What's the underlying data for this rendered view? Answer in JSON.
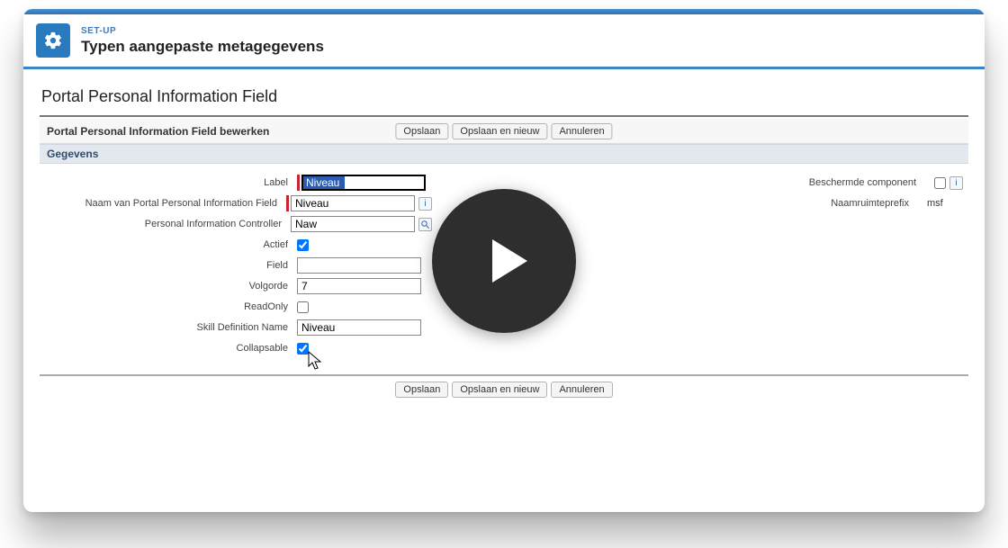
{
  "header": {
    "crumb": "SET-UP",
    "title": "Typen aangepaste metagegevens"
  },
  "page": {
    "title": "Portal Personal Information Field"
  },
  "edit": {
    "bar_title": "Portal Personal Information Field bewerken"
  },
  "buttons": {
    "save": "Opslaan",
    "save_new": "Opslaan en nieuw",
    "cancel": "Annuleren"
  },
  "section": {
    "gegevens": "Gegevens"
  },
  "labels": {
    "label": "Label",
    "name": "Naam van Portal Personal Information Field",
    "controller": "Personal Information Controller",
    "active": "Actief",
    "field": "Field",
    "order": "Volgorde",
    "readonly": "ReadOnly",
    "skill": "Skill Definition Name",
    "collapsable": "Collapsable",
    "protected": "Beschermde component",
    "nsprefix": "Naamruimteprefix"
  },
  "values": {
    "label": "Niveau",
    "name": "Niveau",
    "controller": "Naw",
    "active": true,
    "field": "",
    "order": "7",
    "readonly": false,
    "skill": "Niveau",
    "collapsable": true,
    "protected": false,
    "nsprefix": "msf"
  }
}
